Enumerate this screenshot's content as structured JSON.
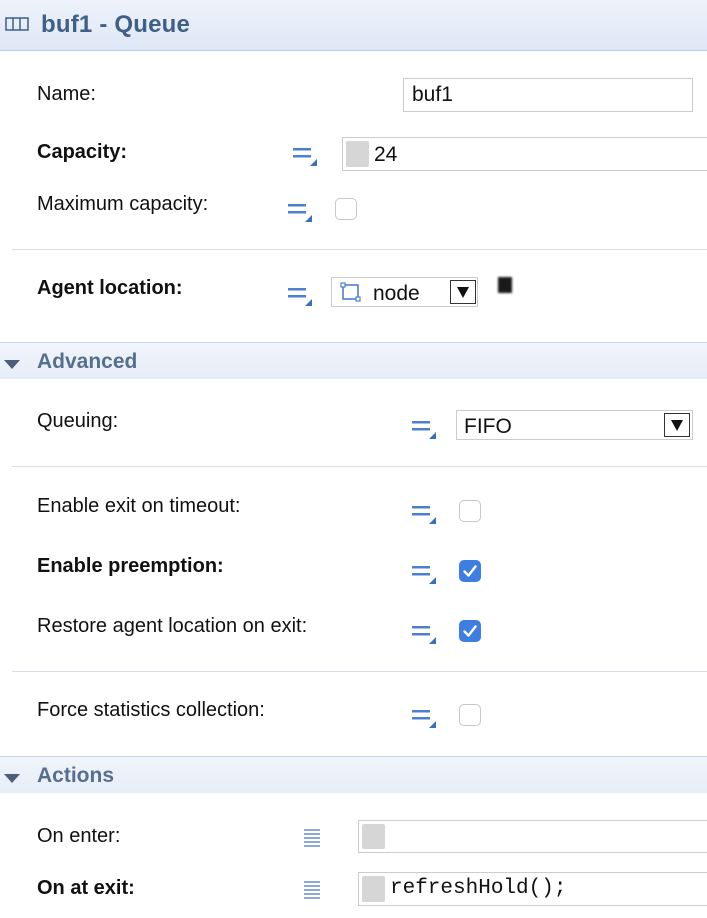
{
  "header": {
    "title": "buf1 - Queue",
    "icon": "queue-icon"
  },
  "properties": {
    "name": {
      "label": "Name:",
      "value": "buf1"
    },
    "capacity": {
      "label": "Capacity:",
      "value": "24"
    },
    "max_capacity": {
      "label": "Maximum capacity:",
      "checked": false
    },
    "agent_location": {
      "label": "Agent location:",
      "value": "node",
      "icon": "node-icon"
    }
  },
  "advanced": {
    "title": "Advanced",
    "queuing": {
      "label": "Queuing:",
      "value": "FIFO"
    },
    "exit_timeout": {
      "label": "Enable exit on timeout:",
      "checked": false
    },
    "preemption": {
      "label": "Enable preemption:",
      "checked": true
    },
    "restore_location": {
      "label": "Restore agent location on exit:",
      "checked": true
    },
    "force_stats": {
      "label": "Force statistics collection:",
      "checked": false
    }
  },
  "actions": {
    "title": "Actions",
    "on_enter": {
      "label": "On enter:",
      "value": ""
    },
    "on_at_exit": {
      "label": "On at exit:",
      "value": "refreshHold();"
    }
  },
  "colors": {
    "accent": "#3d7ee0",
    "header_text": "#3f5f86",
    "section_text": "#566f8f"
  }
}
